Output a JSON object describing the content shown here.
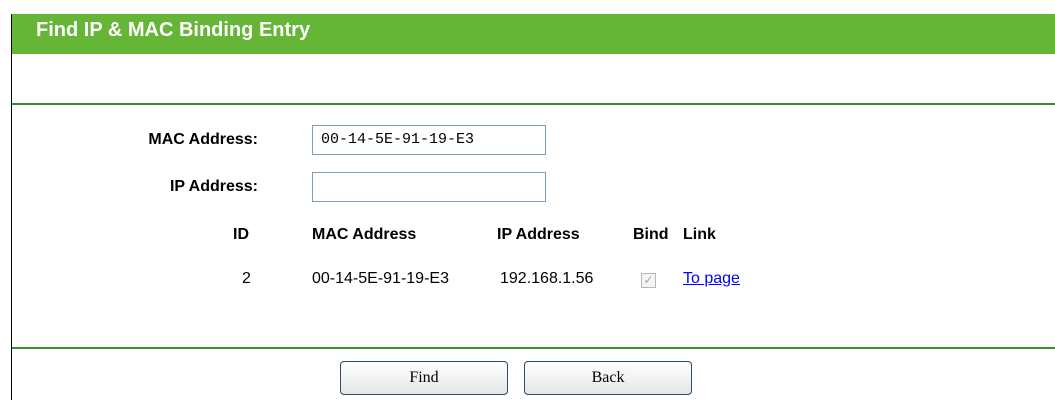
{
  "header": {
    "title": "Find IP & MAC Binding Entry"
  },
  "form": {
    "mac_label": "MAC Address:",
    "mac_value": "00-14-5E-91-19-E3",
    "ip_label": "IP Address:",
    "ip_value": ""
  },
  "table": {
    "columns": [
      "ID",
      "MAC Address",
      "IP Address",
      "Bind",
      "Link"
    ],
    "rows": [
      {
        "id": "2",
        "mac": "00-14-5E-91-19-E3",
        "ip": "192.168.1.56",
        "bind": true,
        "link": "To page"
      }
    ]
  },
  "buttons": {
    "find": "Find",
    "back": "Back"
  },
  "colors": {
    "header": "#65b637",
    "divider": "#378c3a",
    "link": "#0000ff"
  }
}
